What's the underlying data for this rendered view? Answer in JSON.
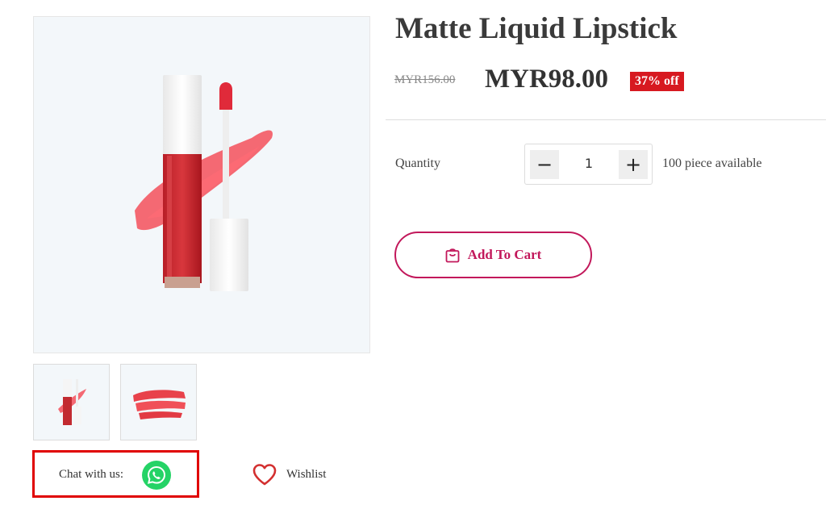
{
  "product": {
    "title": "Matte Liquid Lipstick",
    "old_price": "MYR156.00",
    "new_price": "MYR98.00",
    "discount": "37% off"
  },
  "quantity": {
    "label": "Quantity",
    "value": "1",
    "minus_symbol": "−",
    "plus_symbol": "+",
    "available": "100 piece available"
  },
  "actions": {
    "add_to_cart": "Add To Cart",
    "wishlist": "Wishlist",
    "chat_label": "Chat with us:"
  },
  "icons": {
    "cart": "shopping-bag-icon",
    "wishlist": "heart-icon",
    "chat": "whatsapp-icon"
  },
  "colors": {
    "accent": "#c2185b",
    "discount_badge": "#d71920",
    "whatsapp": "#25d366",
    "highlight_border": "#e00000",
    "heart": "#d32f2f"
  }
}
